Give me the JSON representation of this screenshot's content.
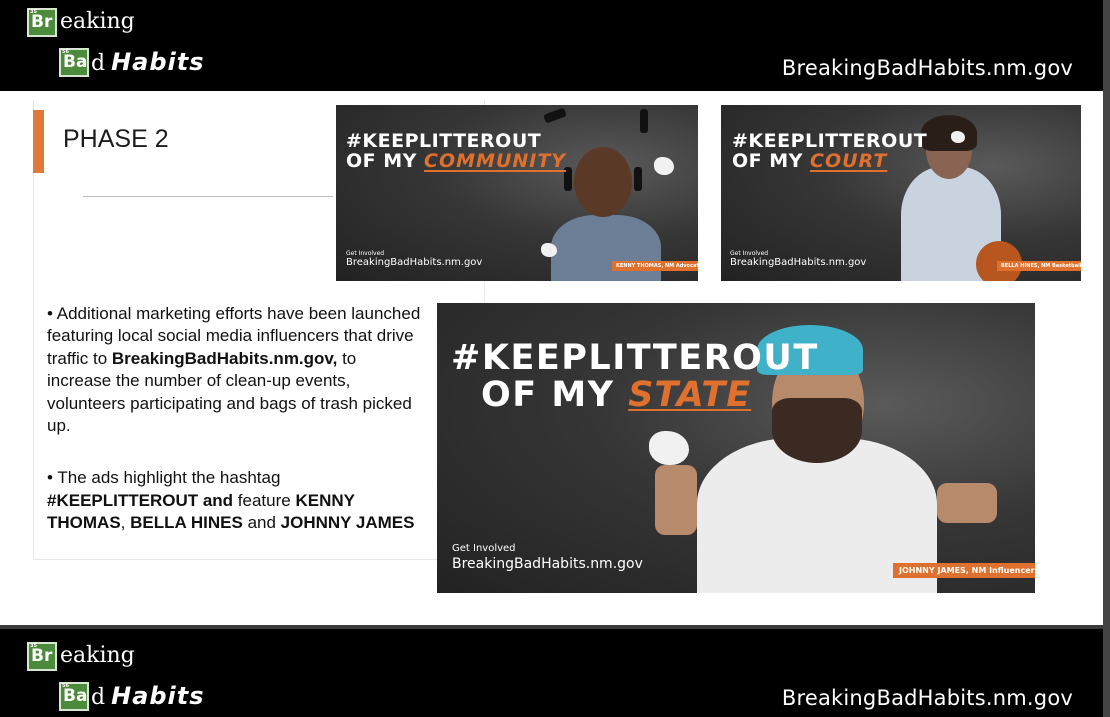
{
  "header": {
    "logo": {
      "symbol1": "Br",
      "text1": "eaking",
      "symbol2": "Ba",
      "text2": "d",
      "text3": "Habits"
    },
    "url": "BreakingBadHabits.nm.gov"
  },
  "footer": {
    "logo": {
      "symbol1": "Br",
      "text1": "eaking",
      "symbol2": "Ba",
      "text2": "d",
      "text3": "Habits"
    },
    "url": "BreakingBadHabits.nm.gov"
  },
  "slide": {
    "title": "PHASE 2",
    "bullets": {
      "b1_pre": "•  Additional marketing efforts have been launched featuring local social media influencers that drive traffic to ",
      "b1_bold": "BreakingBadHabits.nm.gov,",
      "b1_post": " to increase the number of clean-up events, volunteers participating and bags of trash picked up.",
      "b2_pre": "•  The ads highlight the hashtag  ",
      "b2_bold1": "#KEEPLITTEROUT and",
      "b2_mid": "  feature ",
      "b2_name1": "KENNY THOMAS",
      "b2_comma": ", ",
      "b2_name2": "BELLA HINES",
      "b2_and": " and ",
      "b2_name3": "JOHNNY JAMES"
    }
  },
  "ads": [
    {
      "line1": "#KEEPLITTEROUT",
      "line2_pre": "OF MY ",
      "highlight": "COMMUNITY",
      "cta_small": "Get Involved",
      "cta_site": "BreakingBadHabits.nm.gov",
      "credit": "KENNY THOMAS, NM Advocate"
    },
    {
      "line1": "#KEEPLITTEROUT",
      "line2_pre": "OF MY ",
      "highlight": "COURT",
      "cta_small": "Get Involved",
      "cta_site": "BreakingBadHabits.nm.gov",
      "credit": "BELLA HINES, NM Basketball Star"
    },
    {
      "line1": "#KEEPLITTEROUT",
      "line2_pre": "OF MY ",
      "highlight": "STATE",
      "cta_small": "Get Involved",
      "cta_site": "BreakingBadHabits.nm.gov",
      "credit": "JOHNNY JAMES, NM Influencer"
    }
  ],
  "colors": {
    "accent_orange": "#e0702d",
    "element_green": "#4c8a3c",
    "bar_black": "#000000"
  }
}
